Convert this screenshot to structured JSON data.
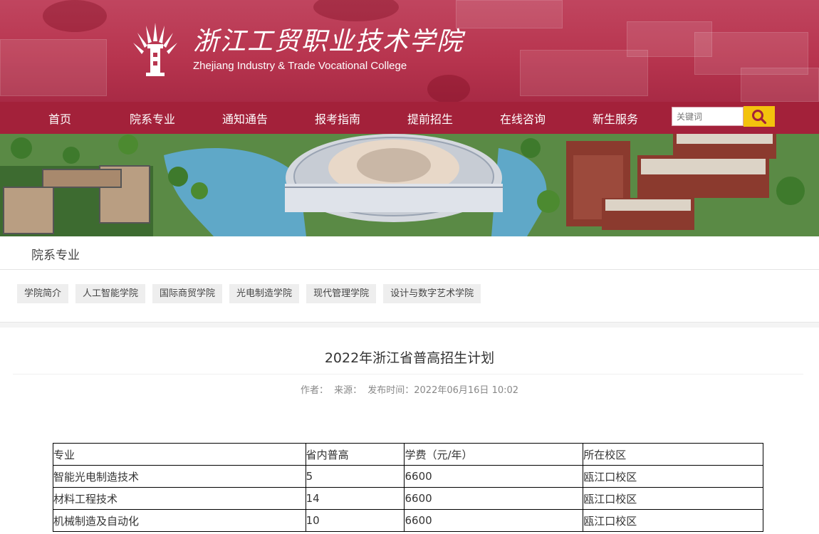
{
  "header": {
    "school_name_cn": "浙江工贸职业技术学院",
    "school_name_en": "Zhejiang Industry & Trade Vocational College",
    "logo_icon": "school-emblem-icon",
    "colors": {
      "banner": "#b8354f",
      "nav": "#a3213a",
      "search_button": "#f3c20d"
    }
  },
  "nav": {
    "items": [
      "首页",
      "院系专业",
      "通知通告",
      "报考指南",
      "提前招生",
      "在线咨询",
      "新生服务"
    ],
    "search_placeholder": "关键词",
    "search_icon": "search-icon"
  },
  "section": {
    "title": "院系专业",
    "subnav": [
      "学院简介",
      "人工智能学院",
      "国际商贸学院",
      "光电制造学院",
      "现代管理学院",
      "设计与数字艺术学院"
    ]
  },
  "article": {
    "title": "2022年浙江省普高招生计划",
    "author_label": "作者：",
    "source_label": "来源：",
    "published": "发布时间：2022年06月16日 10:02"
  },
  "table": {
    "headers": [
      "专业",
      "省内普高",
      "学费（元/年）",
      "所在校区"
    ],
    "rows": [
      [
        "智能光电制造技术",
        "5",
        "6600",
        "瓯江口校区"
      ],
      [
        "材料工程技术",
        "14",
        "6600",
        "瓯江口校区"
      ],
      [
        "机械制造及自动化",
        "10",
        "6600",
        "瓯江口校区"
      ]
    ]
  }
}
